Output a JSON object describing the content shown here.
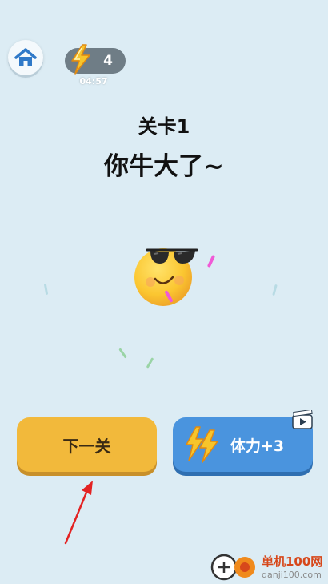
{
  "header": {
    "energy_count": "4",
    "timer": "04:57"
  },
  "level": {
    "title": "关卡1",
    "message": "你牛大了~"
  },
  "buttons": {
    "next_label": "下一关",
    "energy_label": "体力+3"
  },
  "watermark": {
    "name": "单机100网",
    "url": "danji100.com"
  },
  "colors": {
    "background": "#dcecf4",
    "next_button": "#f2b93b",
    "energy_button": "#4a94de",
    "energy_pill": "#6f7d86",
    "bolt": "#f7c52b",
    "arrow": "#e32222"
  },
  "icons": [
    "home-icon",
    "lightning-icon",
    "video-ad-icon",
    "sunglasses-emoji"
  ]
}
